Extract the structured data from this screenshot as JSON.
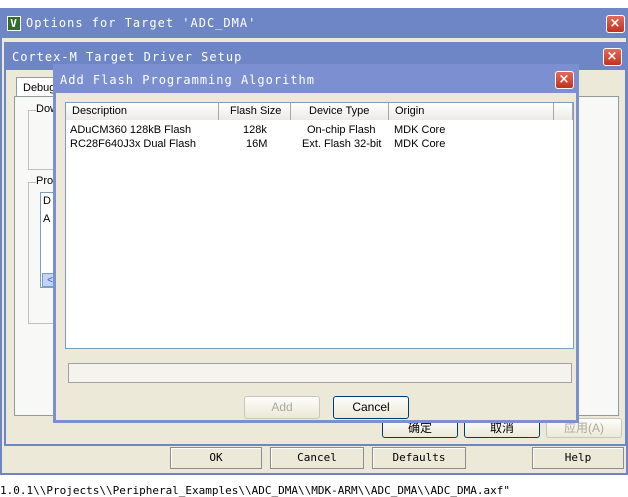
{
  "options_window": {
    "title": "Options for Target 'ADC_DMA'",
    "app_icon_glyph": "V"
  },
  "driver_window": {
    "title": "Cortex-M Target Driver Setup",
    "tab_label": "Debug",
    "group1_label": "Dow",
    "group2_label": "Pro",
    "list_header_stub": "D",
    "list_row_stub": "A",
    "scroll_left_glyph": "<"
  },
  "dialog": {
    "title": "Add Flash Programming Algorithm",
    "columns": [
      "Description",
      "Flash Size",
      "Device Type",
      "Origin"
    ],
    "rows": [
      {
        "description": "ADuCM360 128kB Flash",
        "size": "128k",
        "type": "On-chip Flash",
        "origin": "MDK Core"
      },
      {
        "description": "RC28F640J3x Dual Flash",
        "size": "16M",
        "type": "Ext. Flash 32-bit",
        "origin": "MDK Core"
      }
    ],
    "path_field_value": "",
    "add_label": "Add",
    "cancel_label": "Cancel"
  },
  "driver_buttons": {
    "ok": "确定",
    "cancel": "取消",
    "apply": "应用(A)"
  },
  "options_buttons": {
    "ok": "OK",
    "cancel": "Cancel",
    "defaults": "Defaults",
    "help": "Help"
  },
  "status_path": "1.0.1\\\\Projects\\\\Peripheral_Examples\\\\ADC_DMA\\\\MDK-ARM\\\\ADC_DMA\\\\ADC_DMA.axf\"",
  "colors": {
    "titlebar": "#6f86c6",
    "dialog_border": "#7b8fd1",
    "face": "#ece9d8"
  },
  "icons": {
    "close": "close-icon",
    "app": "uvision-icon"
  }
}
